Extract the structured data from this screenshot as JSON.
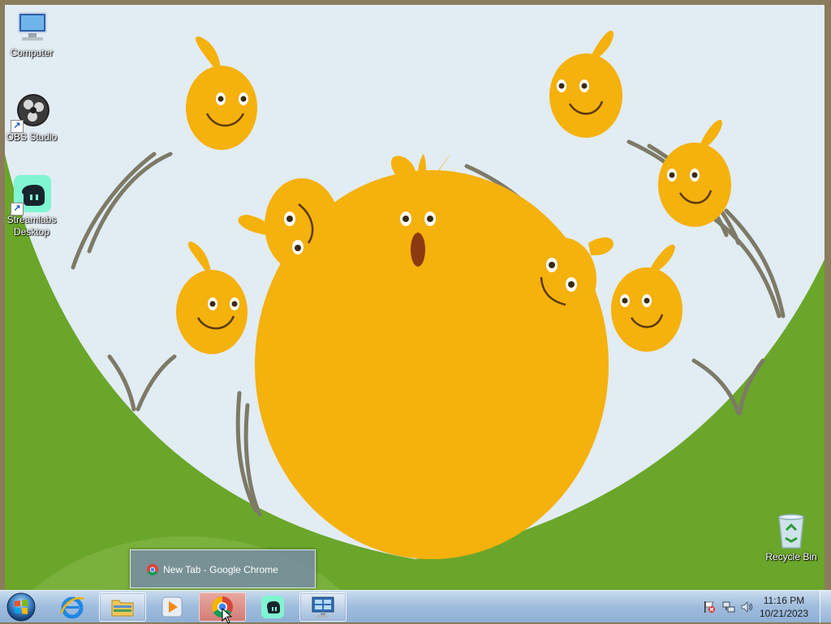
{
  "desktop": {
    "icons": [
      {
        "label": "Computer",
        "icon": "computer-icon"
      },
      {
        "label": "OBS Studio",
        "icon": "obs-studio-icon"
      },
      {
        "label": "Streamlabs Desktop",
        "icon": "streamlabs-icon"
      },
      {
        "label": "Recycle Bin",
        "icon": "recycle-bin-icon"
      }
    ],
    "wallpaper": "yellow-chicks-on-green-hill",
    "colors": {
      "sky": "#e2ecf3",
      "grass": "#6aa62a",
      "chick": "#f5b10c",
      "frame": "#8a7c5c"
    }
  },
  "thumbnail": {
    "title": "New Tab - Google Chrome",
    "icon": "chrome-icon"
  },
  "taskbar": {
    "start": "windows-start-icon",
    "buttons": [
      {
        "name": "internet-explorer",
        "icon": "internet-explorer-icon"
      },
      {
        "name": "file-explorer",
        "icon": "folder-icon"
      },
      {
        "name": "media-player",
        "icon": "media-player-icon"
      },
      {
        "name": "chrome",
        "icon": "chrome-icon"
      },
      {
        "name": "streamlabs",
        "icon": "streamlabs-icon"
      },
      {
        "name": "control-panel",
        "icon": "control-panel-icon"
      }
    ],
    "clock": {
      "time": "11:16 PM",
      "date": "10/21/2023"
    },
    "tray": [
      "action-center-flag-icon",
      "network-icon",
      "volume-icon"
    ]
  }
}
